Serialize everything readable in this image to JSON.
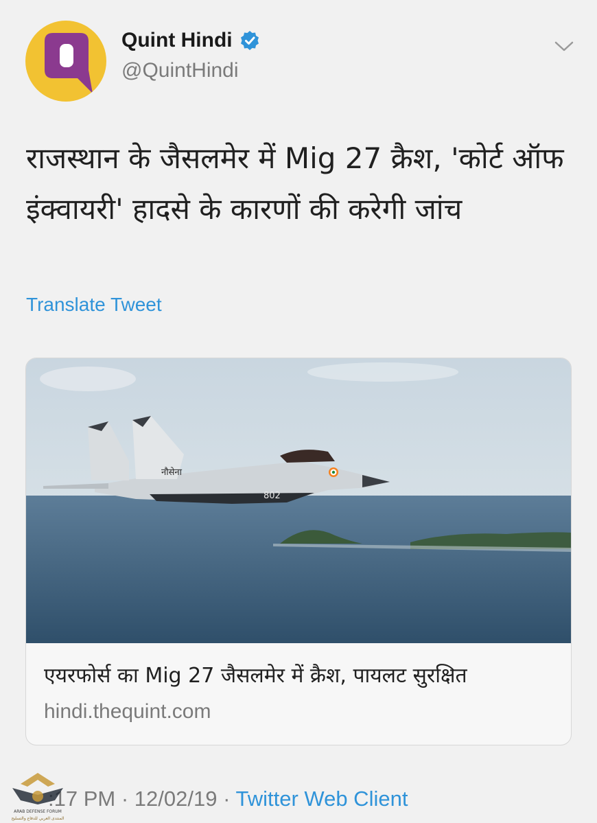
{
  "account": {
    "name": "Quint Hindi",
    "handle": "@QuintHindi",
    "verified": true,
    "avatar_icon": "quint-q-logo-icon"
  },
  "tweet": {
    "text": "राजस्थान के जैसलमेर में Mig 27 क्रैश, 'कोर्ट ऑफ इंक्वायरी' हादसे के कारणों की करेगी जांच",
    "translate_label": "Translate Tweet"
  },
  "card": {
    "image_alt": "Fighter jet flying over the sea near islands",
    "jet_marking": "नौसेना",
    "jet_number": "802",
    "title": "एयरफोर्स का Mig 27 जैसलमेर में क्रैश, पायलट सुरक्षित",
    "domain": "hindi.thequint.com"
  },
  "meta": {
    "time": ":17 PM",
    "separator": "·",
    "date": "12/02/19",
    "client": "Twitter Web Client"
  },
  "watermark": {
    "text_line1": "ARAB DEFENSE FORUM",
    "text_line2": "المنتدى العربي للدفاع والتسليح"
  },
  "colors": {
    "background": "#f1f1f1",
    "link": "#2f93d9",
    "avatar_bg": "#f2c232",
    "avatar_logo": "#8b3a8f",
    "verified": "#2f93d9"
  }
}
